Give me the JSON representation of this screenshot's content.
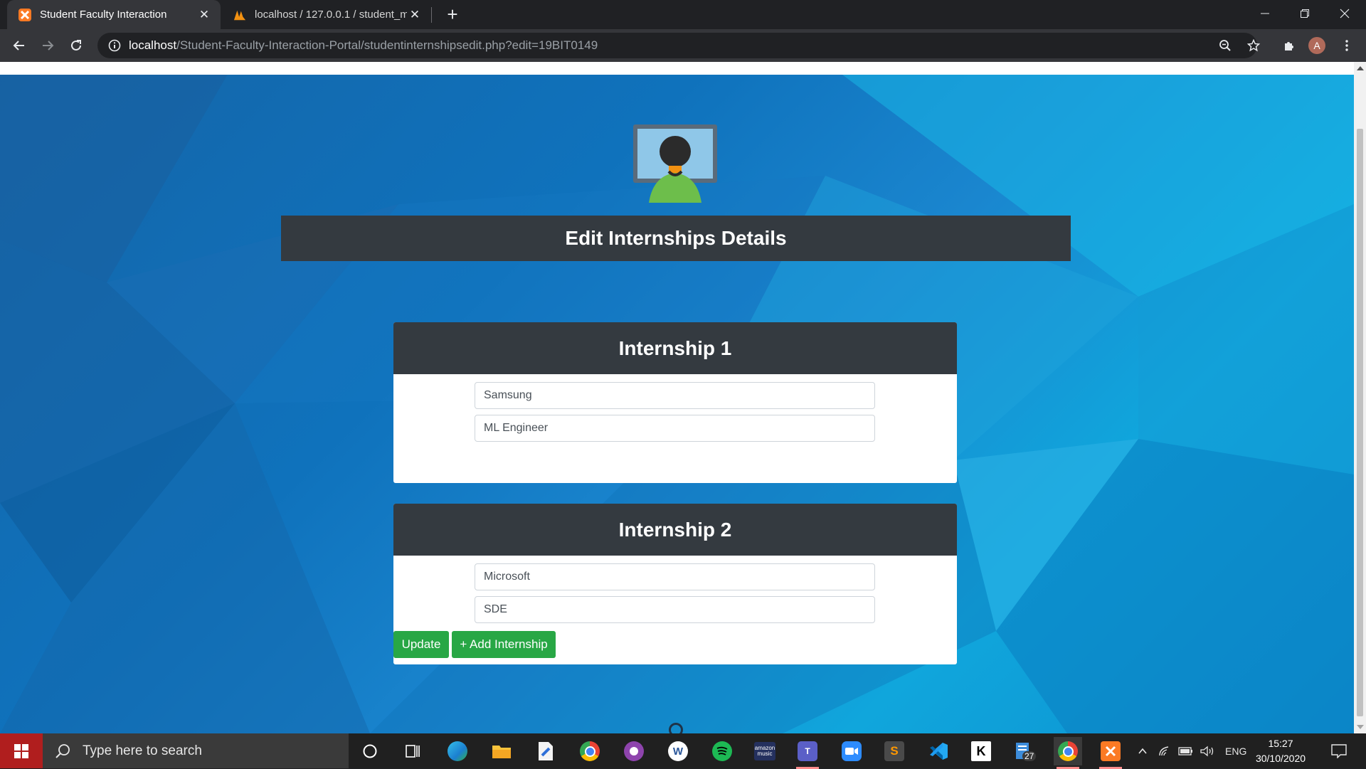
{
  "browser": {
    "tabs": [
      {
        "title": "Student Faculty Interaction",
        "active": true,
        "favicon": "xampp-icon"
      },
      {
        "title": "localhost / 127.0.0.1 / student_m",
        "active": false,
        "favicon": "phpmyadmin-icon"
      }
    ],
    "url_host": "localhost",
    "url_path": "/Student-Faculty-Interaction-Portal/studentinternshipsedit.php?edit=19BIT0149",
    "profile_initial": "A"
  },
  "page": {
    "heading": "Edit Internships Details",
    "internships": [
      {
        "title": "Internship 1",
        "company": "Samsung",
        "role": "ML Engineer"
      },
      {
        "title": "Internship 2",
        "company": "Microsoft",
        "role": "SDE"
      }
    ],
    "buttons": {
      "update": "Update",
      "add": "+ Add Internship"
    }
  },
  "taskbar": {
    "search_placeholder": "Type here to search",
    "badge_count": "27",
    "language": "ENG",
    "time": "15:27",
    "date": "30/10/2020",
    "apps": [
      "cortana-icon",
      "task-view-icon",
      "edge-icon",
      "file-explorer-icon",
      "paint-icon",
      "chrome-icon",
      "github-desktop-icon",
      "word-icon",
      "spotify-icon",
      "amazon-music-icon",
      "teams-icon",
      "zoom-icon",
      "sublime-text-icon",
      "vscode-icon",
      "kotlin-icon",
      "notepad-icon",
      "chrome-running-icon",
      "xampp-icon"
    ],
    "amazon_music_label": "amazon music"
  },
  "colors": {
    "accent_green": "#28a745",
    "banner_dark": "#343a40",
    "chrome_dark": "#202124"
  }
}
